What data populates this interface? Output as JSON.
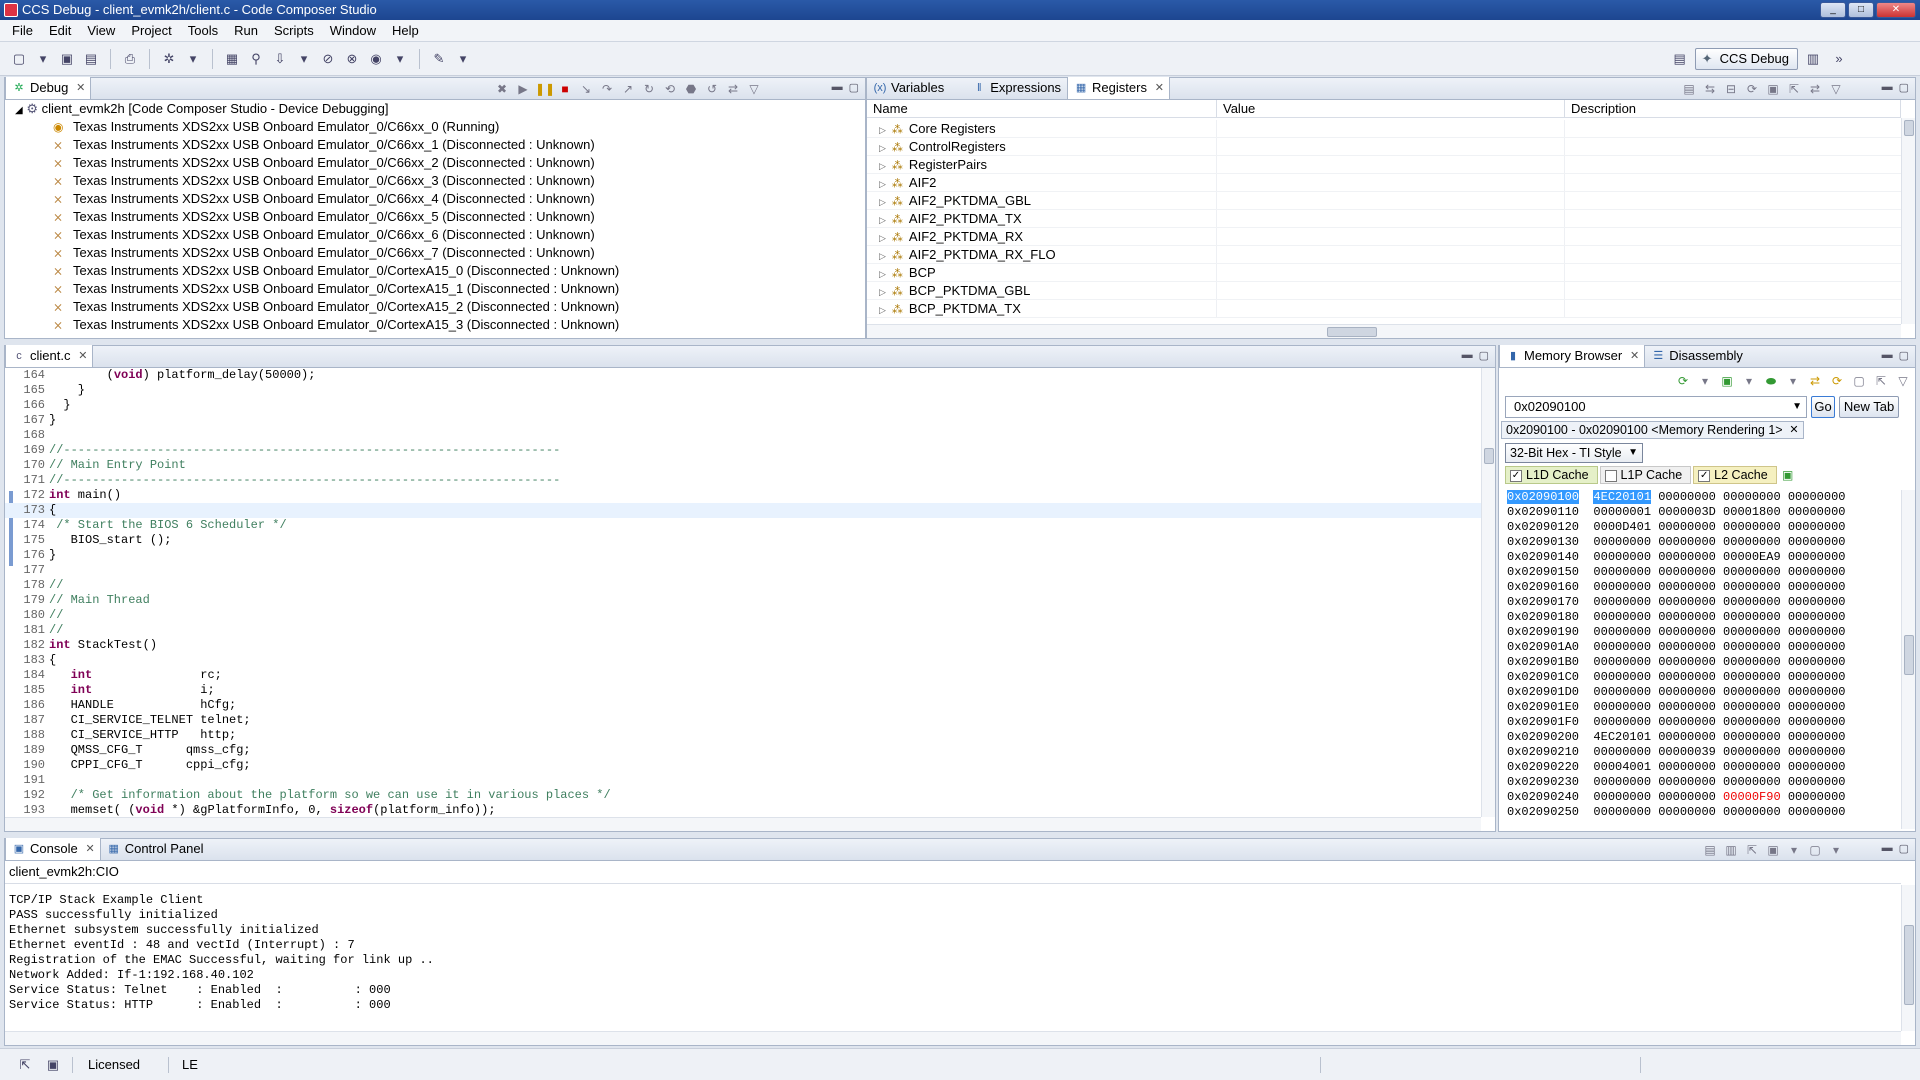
{
  "window": {
    "title": "CCS Debug - client_evmk2h/client.c - Code Composer Studio",
    "buttons": [
      "_",
      "□",
      "✕"
    ]
  },
  "menu": [
    "File",
    "Edit",
    "View",
    "Project",
    "Tools",
    "Run",
    "Scripts",
    "Window",
    "Help"
  ],
  "perspective": {
    "label": "CCS Debug"
  },
  "debug": {
    "tab": "Debug",
    "root": "client_evmk2h [Code Composer Studio - Device Debugging]",
    "items": [
      "Texas Instruments XDS2xx USB Onboard Emulator_0/C66xx_0 (Running)",
      "Texas Instruments XDS2xx USB Onboard Emulator_0/C66xx_1 (Disconnected : Unknown)",
      "Texas Instruments XDS2xx USB Onboard Emulator_0/C66xx_2 (Disconnected : Unknown)",
      "Texas Instruments XDS2xx USB Onboard Emulator_0/C66xx_3 (Disconnected : Unknown)",
      "Texas Instruments XDS2xx USB Onboard Emulator_0/C66xx_4 (Disconnected : Unknown)",
      "Texas Instruments XDS2xx USB Onboard Emulator_0/C66xx_5 (Disconnected : Unknown)",
      "Texas Instruments XDS2xx USB Onboard Emulator_0/C66xx_6 (Disconnected : Unknown)",
      "Texas Instruments XDS2xx USB Onboard Emulator_0/C66xx_7 (Disconnected : Unknown)",
      "Texas Instruments XDS2xx USB Onboard Emulator_0/CortexA15_0 (Disconnected : Unknown)",
      "Texas Instruments XDS2xx USB Onboard Emulator_0/CortexA15_1 (Disconnected : Unknown)",
      "Texas Instruments XDS2xx USB Onboard Emulator_0/CortexA15_2 (Disconnected : Unknown)",
      "Texas Instruments XDS2xx USB Onboard Emulator_0/CortexA15_3 (Disconnected : Unknown)"
    ]
  },
  "registers": {
    "tabs": [
      "Variables",
      "Expressions",
      "Registers"
    ],
    "columns": [
      "Name",
      "Value",
      "Description"
    ],
    "rows": [
      "Core Registers",
      "ControlRegisters",
      "RegisterPairs",
      "AIF2",
      "AIF2_PKTDMA_GBL",
      "AIF2_PKTDMA_TX",
      "AIF2_PKTDMA_RX",
      "AIF2_PKTDMA_RX_FLO",
      "BCP",
      "BCP_PKTDMA_GBL",
      "BCP_PKTDMA_TX"
    ]
  },
  "editor": {
    "tab": "client.c",
    "lines": [
      {
        "n": "164",
        "t": "        (void) platform_delay(50000);"
      },
      {
        "n": "165",
        "t": "    }"
      },
      {
        "n": "166",
        "t": "  }"
      },
      {
        "n": "167",
        "t": "}"
      },
      {
        "n": "168",
        "t": ""
      },
      {
        "n": "169",
        "t": "//---------------------------------------------------------------------"
      },
      {
        "n": "170",
        "t": "// Main Entry Point"
      },
      {
        "n": "171",
        "t": "//---------------------------------------------------------------------"
      },
      {
        "n": "172",
        "t": "int main()"
      },
      {
        "n": "173",
        "t": "{"
      },
      {
        "n": "174",
        "t": " /* Start the BIOS 6 Scheduler */"
      },
      {
        "n": "175",
        "t": "   BIOS_start ();"
      },
      {
        "n": "176",
        "t": "}"
      },
      {
        "n": "177",
        "t": ""
      },
      {
        "n": "178",
        "t": "//"
      },
      {
        "n": "179",
        "t": "// Main Thread"
      },
      {
        "n": "180",
        "t": "//"
      },
      {
        "n": "181",
        "t": "//"
      },
      {
        "n": "182",
        "t": "int StackTest()"
      },
      {
        "n": "183",
        "t": "{"
      },
      {
        "n": "184",
        "t": "   int               rc;"
      },
      {
        "n": "185",
        "t": "   int               i;"
      },
      {
        "n": "186",
        "t": "   HANDLE            hCfg;"
      },
      {
        "n": "187",
        "t": "   CI_SERVICE_TELNET telnet;"
      },
      {
        "n": "188",
        "t": "   CI_SERVICE_HTTP   http;"
      },
      {
        "n": "189",
        "t": "   QMSS_CFG_T      qmss_cfg;"
      },
      {
        "n": "190",
        "t": "   CPPI_CFG_T      cppi_cfg;"
      },
      {
        "n": "191",
        "t": ""
      },
      {
        "n": "192",
        "t": "   /* Get information about the platform so we can use it in various places */"
      },
      {
        "n": "193",
        "t": "   memset( (void *) &gPlatformInfo, 0, sizeof(platform_info));"
      }
    ]
  },
  "memory": {
    "tabs": [
      "Memory Browser",
      "Disassembly"
    ],
    "address_input": "0x02090100",
    "go_label": "Go",
    "newtab_label": "New Tab",
    "rendering_tab": "0x2090100 - 0x02090100 <Memory Rendering 1>",
    "format": "32-Bit Hex - TI Style",
    "caches": [
      {
        "label": "L1D Cache",
        "checked": true
      },
      {
        "label": "L1P Cache",
        "checked": false
      },
      {
        "label": "L2 Cache",
        "checked": true
      }
    ],
    "rows": [
      {
        "a": "0x02090100",
        "v": [
          "4EC20101",
          "00000000",
          "00000000",
          "00000000"
        ]
      },
      {
        "a": "0x02090110",
        "v": [
          "00000001",
          "0000003D",
          "00001800",
          "00000000"
        ]
      },
      {
        "a": "0x02090120",
        "v": [
          "0000D401",
          "00000000",
          "00000000",
          "00000000"
        ]
      },
      {
        "a": "0x02090130",
        "v": [
          "00000000",
          "00000000",
          "00000000",
          "00000000"
        ]
      },
      {
        "a": "0x02090140",
        "v": [
          "00000000",
          "00000000",
          "00000EA9",
          "00000000"
        ]
      },
      {
        "a": "0x02090150",
        "v": [
          "00000000",
          "00000000",
          "00000000",
          "00000000"
        ]
      },
      {
        "a": "0x02090160",
        "v": [
          "00000000",
          "00000000",
          "00000000",
          "00000000"
        ]
      },
      {
        "a": "0x02090170",
        "v": [
          "00000000",
          "00000000",
          "00000000",
          "00000000"
        ]
      },
      {
        "a": "0x02090180",
        "v": [
          "00000000",
          "00000000",
          "00000000",
          "00000000"
        ]
      },
      {
        "a": "0x02090190",
        "v": [
          "00000000",
          "00000000",
          "00000000",
          "00000000"
        ]
      },
      {
        "a": "0x020901A0",
        "v": [
          "00000000",
          "00000000",
          "00000000",
          "00000000"
        ]
      },
      {
        "a": "0x020901B0",
        "v": [
          "00000000",
          "00000000",
          "00000000",
          "00000000"
        ]
      },
      {
        "a": "0x020901C0",
        "v": [
          "00000000",
          "00000000",
          "00000000",
          "00000000"
        ]
      },
      {
        "a": "0x020901D0",
        "v": [
          "00000000",
          "00000000",
          "00000000",
          "00000000"
        ]
      },
      {
        "a": "0x020901E0",
        "v": [
          "00000000",
          "00000000",
          "00000000",
          "00000000"
        ]
      },
      {
        "a": "0x020901F0",
        "v": [
          "00000000",
          "00000000",
          "00000000",
          "00000000"
        ]
      },
      {
        "a": "0x02090200",
        "v": [
          "4EC20101",
          "00000000",
          "00000000",
          "00000000"
        ]
      },
      {
        "a": "0x02090210",
        "v": [
          "00000000",
          "00000039",
          "00000000",
          "00000000"
        ]
      },
      {
        "a": "0x02090220",
        "v": [
          "00004001",
          "00000000",
          "00000000",
          "00000000"
        ]
      },
      {
        "a": "0x02090230",
        "v": [
          "00000000",
          "00000000",
          "00000000",
          "00000000"
        ]
      },
      {
        "a": "0x02090240",
        "v": [
          "00000000",
          "00000000",
          "00000F90",
          "00000000"
        ]
      },
      {
        "a": "0x02090250",
        "v": [
          "00000000",
          "00000000",
          "00000000",
          "00000000"
        ]
      }
    ]
  },
  "console": {
    "tabs": [
      "Console",
      "Control Panel"
    ],
    "header": "client_evmk2h:CIO",
    "lines": [
      "TCP/IP Stack Example Client",
      "PASS successfully initialized",
      "Ethernet subsystem successfully initialized",
      "Ethernet eventId : 48 and vectId (Interrupt) : 7",
      "Registration of the EMAC Successful, waiting for link up ..",
      "Network Added: If-1:192.168.40.102",
      "Service Status: Telnet    : Enabled  :          : 000",
      "Service Status: HTTP      : Enabled  :          : 000"
    ]
  },
  "status": {
    "license": "Licensed",
    "endian": "LE"
  },
  "colors": {
    "selection": "#3399ff",
    "changed_value": "#e00000",
    "keyword": "#7f0055",
    "comment": "#3f7f5f"
  }
}
